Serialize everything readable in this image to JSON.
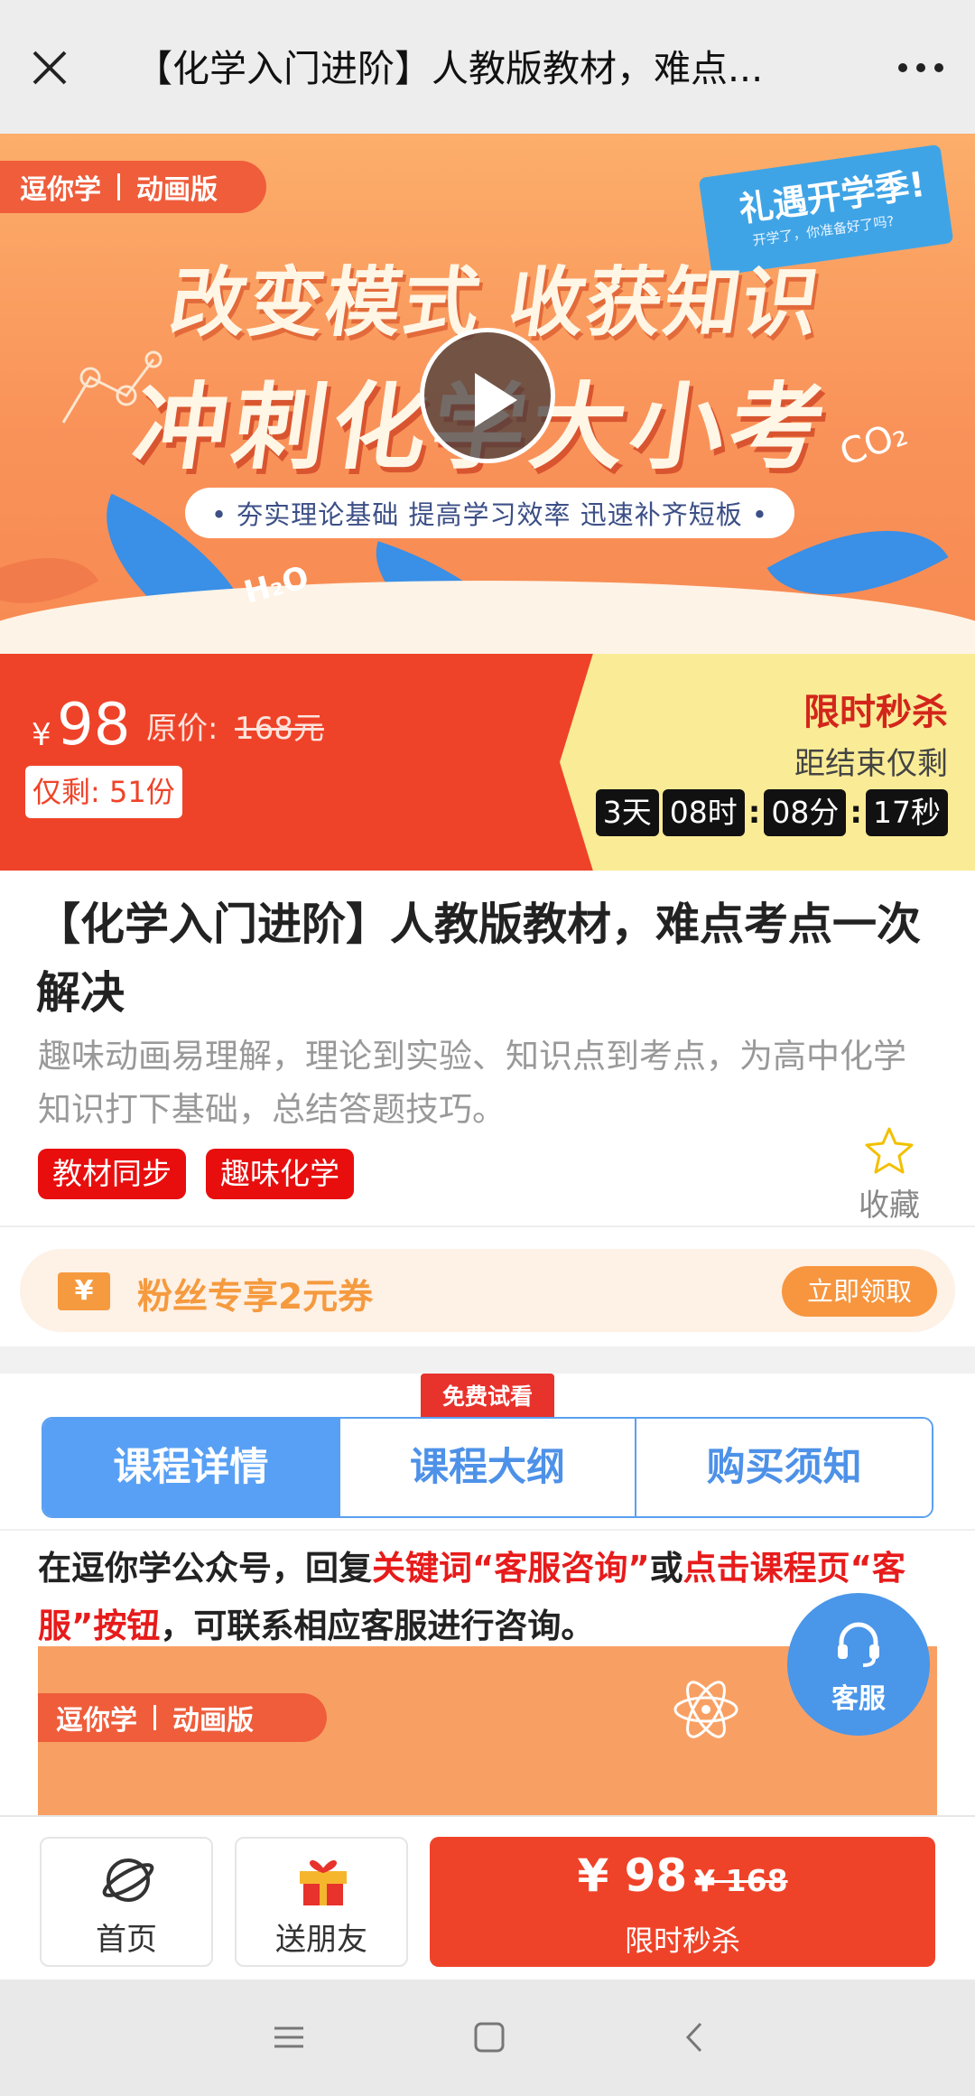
{
  "topbar": {
    "title": "【化学入门进阶】人教版教材，难点...",
    "close_icon": "close-icon",
    "more_icon": "more-icon"
  },
  "banner": {
    "brand": "逗你学",
    "brand_edition": "动画版",
    "headline_1": "改变模式 收获知识",
    "headline_2": "冲刺化学大小考",
    "tagline": "• 夯实理论基础   提高学习效率   迅速补齐短板 •",
    "promo_title": "礼遇开学季!",
    "promo_sub": "开学了，你准备好了吗?",
    "formula_1": "H₂O",
    "formula_2": "CO₂"
  },
  "price": {
    "currency": "¥",
    "current": "98",
    "original_label": "原价:",
    "original_value": "168元",
    "remaining": "仅剩: 51份",
    "flash_label": "限时秒杀",
    "ends_in_label": "距结束仅剩",
    "countdown": {
      "days": "3天",
      "hours": "08时",
      "minutes": "08分",
      "seconds": "17秒"
    }
  },
  "course": {
    "title": "【化学入门进阶】人教版教材，难点考点一次解决",
    "description": "趣味动画易理解，理论到实验、知识点到考点，为高中化学知识打下基础，总结答题技巧。",
    "tags": [
      "教材同步",
      "趣味化学"
    ],
    "favorite_label": "收藏"
  },
  "coupon": {
    "icon_text": "¥",
    "text": "粉丝专享2元券",
    "button": "立即领取"
  },
  "tabs": {
    "badge": "免费试看",
    "items": [
      "课程详情",
      "课程大纲",
      "购买须知"
    ],
    "active_index": 0
  },
  "content": {
    "p_1": "在逗你学公众号，回复",
    "p_hl_1": "关键词“客服咨询”",
    "p_2": "或",
    "p_hl_2": "点击课程页“客服”按钮",
    "p_3": "，可联系相应客服进行咨询。",
    "img_brand": "逗你学",
    "img_edition": "动画版"
  },
  "service": {
    "label": "客服"
  },
  "actionbar": {
    "home": "首页",
    "gift": "送朋友",
    "buy_price": "¥ 98",
    "buy_original": "¥ 168",
    "buy_label": "限时秒杀"
  },
  "colors": {
    "accent_red": "#ef4329",
    "tab_blue": "#58a0f5",
    "coupon_orange": "#f59a3e",
    "countdown_bg": "#faec96"
  }
}
